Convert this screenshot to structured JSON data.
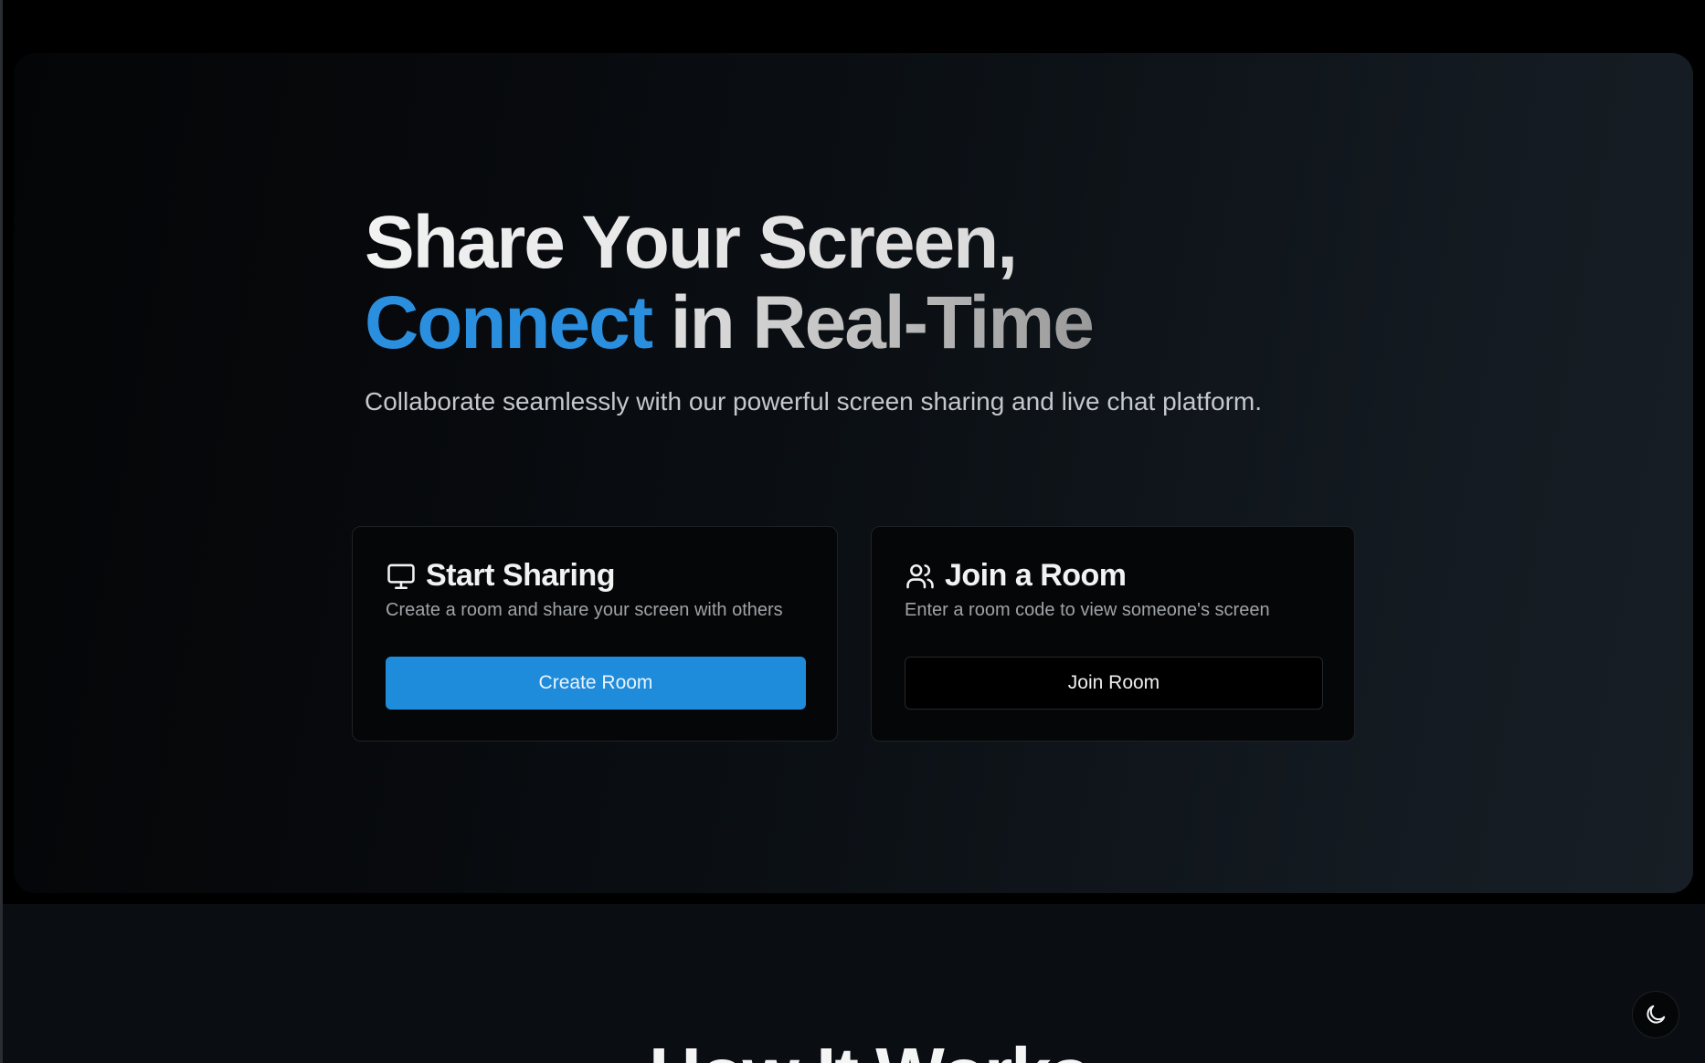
{
  "hero": {
    "title_line1": "Share Your Screen,",
    "title_line2_accent": "Connect",
    "title_line2_rest": " in Real-Time",
    "subtitle": "Collaborate seamlessly with our powerful screen sharing and live chat platform."
  },
  "cards": {
    "share": {
      "icon": "monitor-icon",
      "title": "Start Sharing",
      "description": "Create a room and share your screen with others",
      "button_label": "Create Room"
    },
    "join": {
      "icon": "users-icon",
      "title": "Join a Room",
      "description": "Enter a room code to view someone's screen",
      "button_label": "Join Room"
    }
  },
  "next_section": {
    "heading": "How It Works"
  },
  "theme_toggle": {
    "icon": "moon-icon"
  },
  "colors": {
    "accent": "#2b8fe0",
    "primary_button": "#1f8bdb",
    "background": "#000000"
  }
}
